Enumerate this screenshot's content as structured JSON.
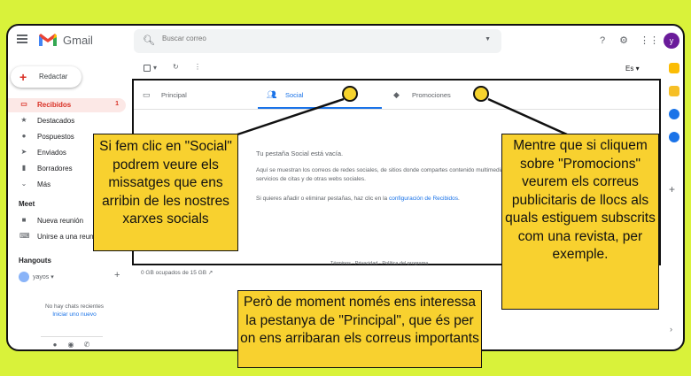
{
  "header": {
    "app_name": "Gmail",
    "search_placeholder": "Buscar correo",
    "avatar_letter": "y"
  },
  "sidebar": {
    "compose_label": "Redactar",
    "items": [
      {
        "label": "Recibidos",
        "count": "1",
        "icon": "inbox-icon"
      },
      {
        "label": "Destacados",
        "icon": "star-icon"
      },
      {
        "label": "Pospuestos",
        "icon": "clock-icon"
      },
      {
        "label": "Enviados",
        "icon": "send-icon"
      },
      {
        "label": "Borradores",
        "icon": "draft-icon"
      },
      {
        "label": "Más",
        "icon": "chevron-down-icon"
      }
    ],
    "meet_title": "Meet",
    "meet_items": [
      {
        "label": "Nueva reunión",
        "icon": "video-icon"
      },
      {
        "label": "Unirse a una reunión",
        "icon": "keyboard-icon"
      }
    ],
    "hangouts_title": "Hangouts",
    "hangouts_user": "yayos",
    "no_recent": "No hay chats recientes",
    "start_new": "Iniciar uno nuevo"
  },
  "toolbar": {
    "language": "Es"
  },
  "tabs": [
    {
      "label": "Principal",
      "icon": "inbox-tab-icon"
    },
    {
      "label": "Social",
      "icon": "people-icon"
    },
    {
      "label": "Promociones",
      "icon": "tag-icon"
    }
  ],
  "empty_state": {
    "title": "Tu pestaña Social está vacía.",
    "description": "Aquí se muestran los correos de redes sociales, de sitios donde compartes contenido multimedia, de servicios de citas y de otras webs sociales.",
    "hint_prefix": "Si quieres añadir o eliminar pestañas, haz clic en la ",
    "hint_link": "configuración de Recibidos",
    "hint_suffix": "."
  },
  "footer": {
    "links": "Términos · Privacidad · Política del programa",
    "storage": "0 GB ocupados de 15 GB"
  },
  "annotations": {
    "social_note": "Si fem clic en \"Social\" podrem veure els missatges que ens arribin de les nostres xarxes socials",
    "promotions_note": "Mentre que si cliquem sobre \"Promocions\" veurem els correus publicitaris de llocs als quals estiguem subscrits com una revista, per exemple.",
    "principal_note": "Però de moment només ens interessa la pestanya de \"Principal\", que és per on ens arribaran els correus importants"
  },
  "colors": {
    "background": "#d9f23a",
    "note_fill": "#f8d12f",
    "gmail_red": "#d93025",
    "link_blue": "#1a73e8"
  }
}
